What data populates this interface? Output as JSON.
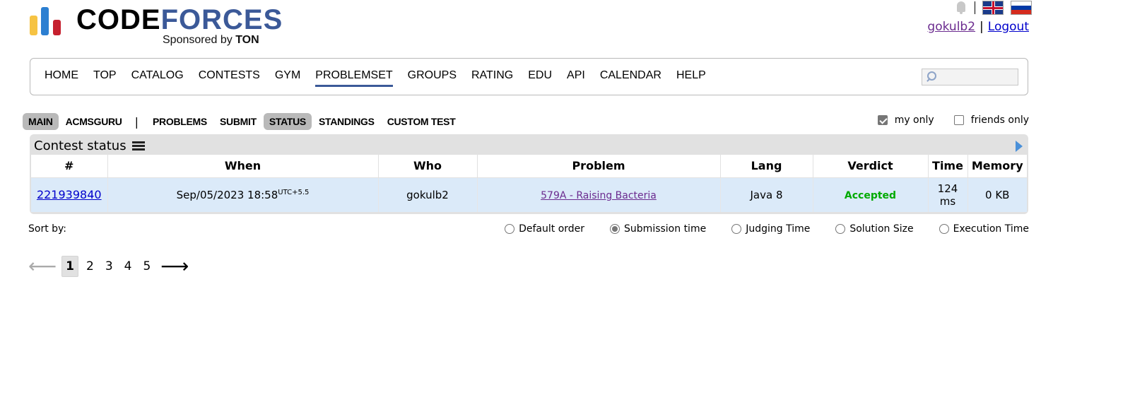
{
  "header": {
    "logo_word_code": "CODE",
    "logo_word_forces": "FORCES",
    "sponsor_prefix": "Sponsored by",
    "sponsor_name": "TON",
    "username": "gokulb2",
    "logout_label": "Logout",
    "separator": "|"
  },
  "main_menu": {
    "items": [
      "HOME",
      "TOP",
      "CATALOG",
      "CONTESTS",
      "GYM",
      "PROBLEMSET",
      "GROUPS",
      "RATING",
      "EDU",
      "API",
      "CALENDAR",
      "HELP"
    ],
    "active": "PROBLEMSET",
    "search_value": ""
  },
  "sub_menu": {
    "items": [
      "MAIN",
      "ACMSGURU",
      "PROBLEMS",
      "SUBMIT",
      "STATUS",
      "STANDINGS",
      "CUSTOM TEST"
    ],
    "selected": [
      "MAIN",
      "STATUS"
    ],
    "separator": "|"
  },
  "filters": {
    "my_only_label": "my only",
    "my_only_checked": true,
    "friends_only_label": "friends only",
    "friends_only_checked": false
  },
  "status": {
    "title": "Contest status",
    "columns": [
      "#",
      "When",
      "Who",
      "Problem",
      "Lang",
      "Verdict",
      "Time",
      "Memory"
    ],
    "rows": [
      {
        "id": "221939840",
        "when": "Sep/05/2023 18:58",
        "tz": "UTC+5.5",
        "who": "gokulb2",
        "problem": "579A - Raising Bacteria",
        "lang": "Java 8",
        "verdict": "Accepted",
        "time_value": "124",
        "time_unit": "ms",
        "memory": "0 KB"
      }
    ]
  },
  "sort": {
    "label": "Sort by:",
    "options": [
      "Default order",
      "Submission time",
      "Judging Time",
      "Solution Size",
      "Execution Time"
    ],
    "selected": "Submission time"
  },
  "pagination": {
    "prev": "⟵",
    "next": "⟶",
    "pages": [
      "1",
      "2",
      "3",
      "4",
      "5"
    ],
    "current": "1"
  },
  "colors": {
    "brand_blue": "#3b5998",
    "row_highlight": "#dbeaf9",
    "accepted_green": "#00aa00",
    "panel_grey": "#e1e1e1"
  }
}
